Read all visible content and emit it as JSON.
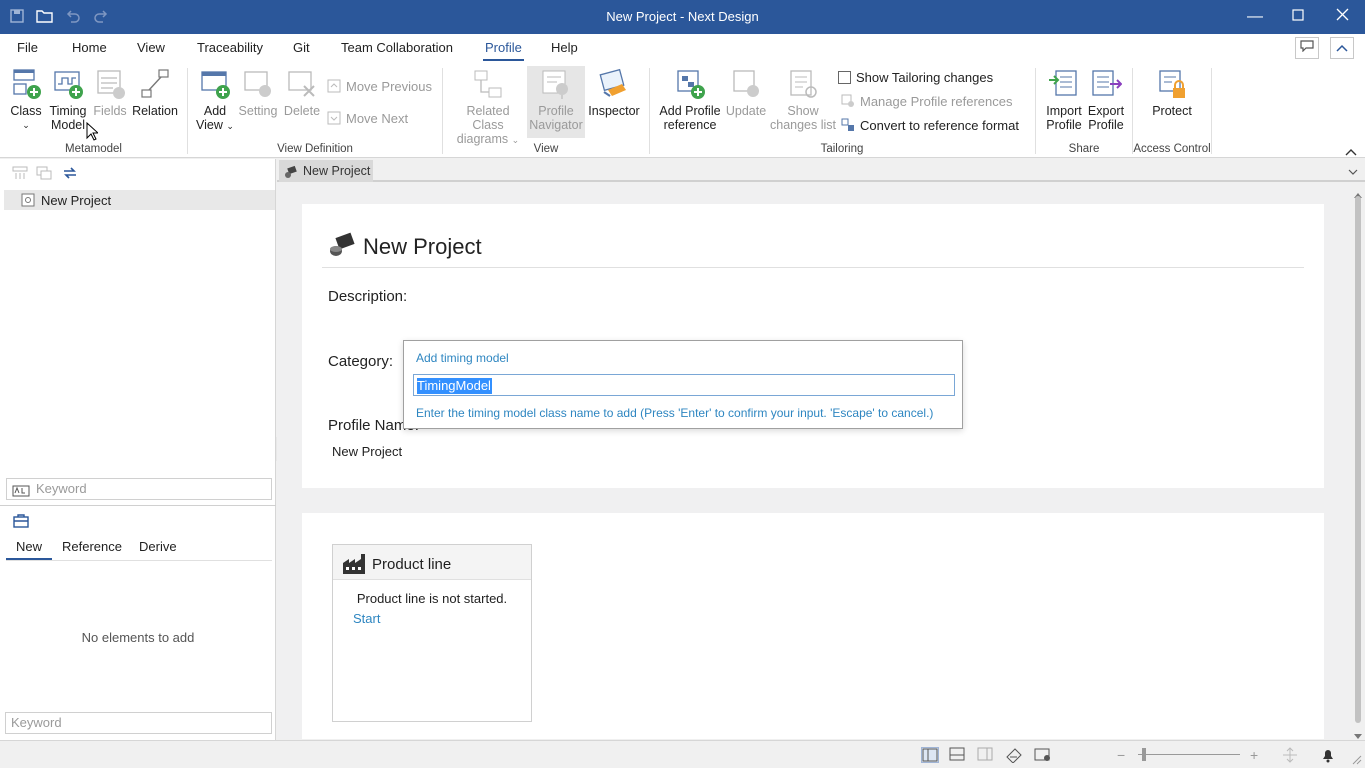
{
  "window": {
    "title": "New Project - Next Design"
  },
  "menu": {
    "tabs": [
      {
        "label": "File"
      },
      {
        "label": "Home"
      },
      {
        "label": "View"
      },
      {
        "label": "Traceability"
      },
      {
        "label": "Git"
      },
      {
        "label": "Team Collaboration"
      },
      {
        "label": "Profile"
      },
      {
        "label": "Help"
      }
    ],
    "active": "Profile"
  },
  "ribbon": {
    "metamodel": {
      "label": "Metamodel",
      "class": "Class",
      "timing_model_1": "Timing",
      "timing_model_2": "Model",
      "fields": "Fields",
      "relation": "Relation"
    },
    "view_definition": {
      "label": "View Definition",
      "add_view_1": "Add",
      "add_view_2": "View",
      "setting": "Setting",
      "delete": "Delete",
      "move_previous": "Move Previous",
      "move_next": "Move Next"
    },
    "view": {
      "label": "View",
      "related_1": "Related Class",
      "related_2": "diagrams",
      "navigator_1": "Profile",
      "navigator_2": "Navigator",
      "inspector": "Inspector"
    },
    "tailoring": {
      "label": "Tailoring",
      "add_ref_1": "Add Profile",
      "add_ref_2": "reference",
      "update": "Update",
      "show_changes_1": "Show",
      "show_changes_2": "changes list",
      "show_tailoring": "Show Tailoring changes",
      "manage_refs": "Manage Profile references",
      "convert": "Convert to reference format"
    },
    "share": {
      "label": "Share",
      "import_1": "Import",
      "import_2": "Profile",
      "export_1": "Export",
      "export_2": "Profile"
    },
    "access": {
      "label": "Access Control",
      "protect": "Protect"
    }
  },
  "left": {
    "tree_item": "New Project",
    "keyword_placeholder": "Keyword",
    "tabs": [
      "New",
      "Reference",
      "Derive"
    ],
    "empty": "No elements to add",
    "keyword_placeholder_2": "Keyword"
  },
  "doc_tab": "New Project",
  "editor": {
    "title": "New Project",
    "description_label": "Description:",
    "category_label": "Category:",
    "profile_name_label": "Profile Name:",
    "profile_name_value": "New Project"
  },
  "popup": {
    "title": "Add timing model",
    "value": "TimingModel",
    "hint": "Enter the timing model class name to add (Press 'Enter' to confirm your input. 'Escape' to cancel.)"
  },
  "product_line": {
    "title": "Product line",
    "status": "Product line is not started.",
    "start": "Start"
  },
  "colors": {
    "accent": "#2b579a",
    "link": "#2e86c1",
    "selection": "#3390ff"
  }
}
